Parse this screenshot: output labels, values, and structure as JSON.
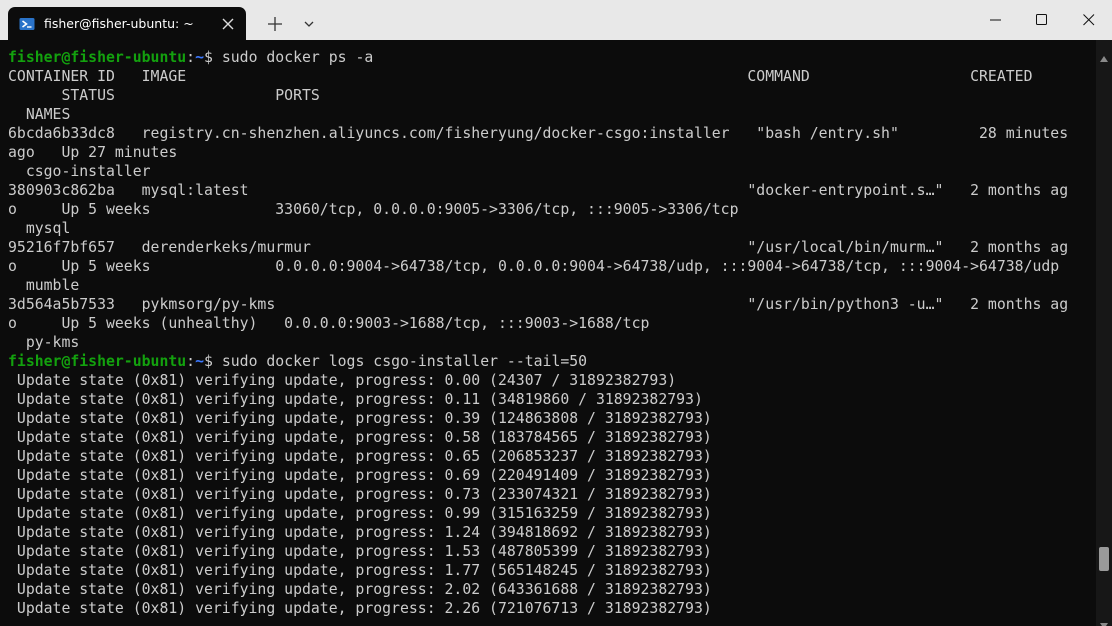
{
  "window": {
    "tab_title": "fisher@fisher-ubuntu: ~",
    "tab_icon": "powershell-icon",
    "new_tab_icon": "plus-icon",
    "dropdown_icon": "chevron-down-icon",
    "controls": [
      "minimize-icon",
      "maximize-icon",
      "close-icon"
    ]
  },
  "colors": {
    "terminal_bg": "#0c0c0c",
    "text": "#cccccc",
    "prompt_user": "#13a10e",
    "prompt_path": "#3b78ff",
    "titlebar_bg": "#e8e8e8"
  },
  "terminal": {
    "prompt": {
      "user": "fisher@fisher-ubuntu",
      "colon": ":",
      "path": "~",
      "symbol": "$ "
    },
    "commands": [
      "sudo docker ps -a",
      "sudo docker logs csgo-installer --tail=50"
    ],
    "ps_output": [
      "CONTAINER ID   IMAGE                                                               COMMAND                  CREATED",
      "      STATUS                  PORTS",
      "  NAMES",
      "6bcda6b33dc8   registry.cn-shenzhen.aliyuncs.com/fisheryung/docker-csgo:installer   \"bash /entry.sh\"         28 minutes",
      "ago   Up 27 minutes",
      "  csgo-installer",
      "380903c862ba   mysql:latest                                                        \"docker-entrypoint.s…\"   2 months ag",
      "o     Up 5 weeks              33060/tcp, 0.0.0.0:9005->3306/tcp, :::9005->3306/tcp",
      "  mysql",
      "95216f7bf657   derenderkeks/murmur                                                 \"/usr/local/bin/murm…\"   2 months ag",
      "o     Up 5 weeks              0.0.0.0:9004->64738/tcp, 0.0.0.0:9004->64738/udp, :::9004->64738/tcp, :::9004->64738/udp",
      "  mumble",
      "3d564a5b7533   pykmsorg/py-kms                                                     \"/usr/bin/python3 -u…\"   2 months ag",
      "o     Up 5 weeks (unhealthy)   0.0.0.0:9003->1688/tcp, :::9003->1688/tcp",
      "  py-kms"
    ],
    "logs_output": [
      " Update state (0x81) verifying update, progress: 0.00 (24307 / 31892382793)",
      " Update state (0x81) verifying update, progress: 0.11 (34819860 / 31892382793)",
      " Update state (0x81) verifying update, progress: 0.39 (124863808 / 31892382793)",
      " Update state (0x81) verifying update, progress: 0.58 (183784565 / 31892382793)",
      " Update state (0x81) verifying update, progress: 0.65 (206853237 / 31892382793)",
      " Update state (0x81) verifying update, progress: 0.69 (220491409 / 31892382793)",
      " Update state (0x81) verifying update, progress: 0.73 (233074321 / 31892382793)",
      " Update state (0x81) verifying update, progress: 0.99 (315163259 / 31892382793)",
      " Update state (0x81) verifying update, progress: 1.24 (394818692 / 31892382793)",
      " Update state (0x81) verifying update, progress: 1.53 (487805399 / 31892382793)",
      " Update state (0x81) verifying update, progress: 1.77 (565148245 / 31892382793)",
      " Update state (0x81) verifying update, progress: 2.02 (643361688 / 31892382793)",
      " Update state (0x81) verifying update, progress: 2.26 (721076713 / 31892382793)"
    ]
  },
  "scrollbar": {
    "position_fraction": 0.94,
    "up_icon": "arrow-up-icon",
    "down_icon": "arrow-down-icon"
  }
}
